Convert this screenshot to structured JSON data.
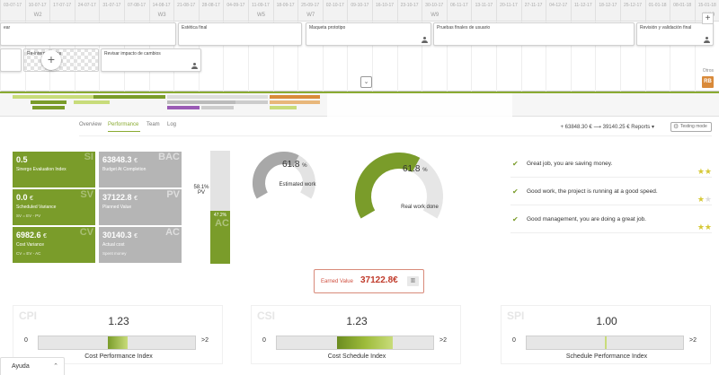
{
  "gantt": {
    "timeline_dates": [
      "03-07-17",
      "10-07-17",
      "17-07-17",
      "24-07-17",
      "31-07-17",
      "07-08-17",
      "14-08-17",
      "21-08-17",
      "28-08-17",
      "04-09-17",
      "11-09-17",
      "18-09-17",
      "25-09-17",
      "02-10-17",
      "09-10-17",
      "16-10-17",
      "23-10-17",
      "30-10-17",
      "06-11-17",
      "13-11-17",
      "20-11-17",
      "27-11-17",
      "04-12-17",
      "11-12-17",
      "18-12-17",
      "25-12-17",
      "01-01-18",
      "08-01-18",
      "15-01-18"
    ],
    "week_labels": [
      "W2",
      "W3",
      "W5",
      "W7",
      "W9",
      "W10"
    ],
    "tasks_row1": [
      "ear",
      "Estética final",
      "Maqueta prototipo",
      "Pruebas finales de usuario",
      "Revisión y validación final"
    ],
    "tasks_row2": [
      "Re-intern...cados",
      "Revisar impacto de cambios"
    ],
    "add_button": "+",
    "collapse_icon": "⌄",
    "others_label": "Otros",
    "badge": "RB"
  },
  "tabs": [
    {
      "label": "Overview",
      "active": false
    },
    {
      "label": "Performance",
      "active": true
    },
    {
      "label": "Team",
      "active": false
    },
    {
      "label": "Log",
      "active": false
    }
  ],
  "topbar": {
    "summary": "+ 63848.30 € ⟶ 39140.25 € Reports ▾",
    "testing_mode": "Testing mode"
  },
  "cards": [
    {
      "value": "0.5",
      "unit": "",
      "label": "Sinergo Evaluation Index",
      "sub": "",
      "abbr": "SI",
      "color": "green"
    },
    {
      "value": "63848.3",
      "unit": "€",
      "label": "Budget At Completion",
      "sub": "",
      "abbr": "BAC",
      "color": "gray"
    },
    {
      "value": "0.0",
      "unit": "€",
      "label": "Scheduled Variance",
      "sub": "SV = EV - PV",
      "abbr": "SV",
      "color": "green"
    },
    {
      "value": "37122.8",
      "unit": "€",
      "label": "Planned Value",
      "sub": "",
      "abbr": "PV",
      "color": "gray"
    },
    {
      "value": "6982.6",
      "unit": "€",
      "label": "Cost Variance",
      "sub": "CV = EV - AC",
      "abbr": "CV",
      "color": "green"
    },
    {
      "value": "30140.3",
      "unit": "€",
      "label": "Actual cost",
      "sub": "Spent money",
      "abbr": "AC",
      "color": "gray"
    }
  ],
  "vbar": {
    "pv_label": "58.1%",
    "pv_tag": "PV",
    "fill_fraction": 0.472,
    "fill_label": "47.2%",
    "ac_tag": "AC"
  },
  "gauges": {
    "estimated": {
      "value": "61.8",
      "unit": "%",
      "caption": "Estimated work",
      "fraction": 0.618
    },
    "real": {
      "value": "61.8",
      "unit": "%",
      "caption": "Real work done",
      "fraction": 0.618
    }
  },
  "messages": [
    {
      "text": "Great job, you are saving money.",
      "stars": 2
    },
    {
      "text": "Good work, the project is running at a good speed.",
      "stars": 1
    },
    {
      "text": "Good management, you are doing a great job.",
      "stars": 2
    }
  ],
  "earned_value": {
    "label": "Earned Value",
    "value": "37122.8€"
  },
  "indices": [
    {
      "abbr": "CPI",
      "value": "1.23",
      "min": "0",
      "max": ">2",
      "name": "Cost Performance Index",
      "fraction": 0.615,
      "style": "narrow"
    },
    {
      "abbr": "CSI",
      "value": "1.23",
      "min": "0",
      "max": ">2",
      "name": "Cost Schedule Index",
      "fraction": 0.615,
      "style": "wide"
    },
    {
      "abbr": "SPI",
      "value": "1.00",
      "min": "0",
      "max": ">2",
      "name": "Schedule Performance Index",
      "fraction": 0.5,
      "style": "line"
    }
  ],
  "colors": {
    "green": "#7a9c2a",
    "light_green": "#c8dc7a",
    "gray": "#b5b5b5",
    "red": "#c03a2a",
    "orange": "#d98a3a",
    "purple": "#9a5bb5"
  },
  "help": {
    "label": "Ayuda",
    "chevron": "⌃"
  }
}
